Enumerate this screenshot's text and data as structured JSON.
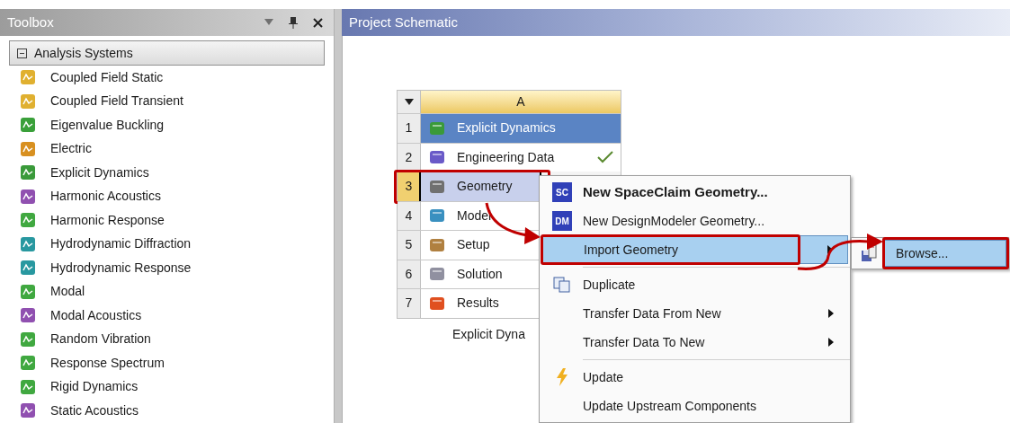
{
  "toolbox": {
    "title": "Toolbox",
    "section": {
      "label": "Analysis Systems",
      "expanded": true
    },
    "items": [
      {
        "label": "Coupled Field Static",
        "color": "#e0b030"
      },
      {
        "label": "Coupled Field Transient",
        "color": "#e0b030"
      },
      {
        "label": "Eigenvalue Buckling",
        "color": "#3aa03a"
      },
      {
        "label": "Electric",
        "color": "#d89020"
      },
      {
        "label": "Explicit Dynamics",
        "color": "#3a9a3a"
      },
      {
        "label": "Harmonic Acoustics",
        "color": "#9050b0"
      },
      {
        "label": "Harmonic Response",
        "color": "#40a840"
      },
      {
        "label": "Hydrodynamic Diffraction",
        "color": "#2898a0"
      },
      {
        "label": "Hydrodynamic Response",
        "color": "#2898a0"
      },
      {
        "label": "Modal",
        "color": "#40a840"
      },
      {
        "label": "Modal Acoustics",
        "color": "#9050b0"
      },
      {
        "label": "Random Vibration",
        "color": "#40a840"
      },
      {
        "label": "Response Spectrum",
        "color": "#40a840"
      },
      {
        "label": "Rigid Dynamics",
        "color": "#40a840"
      },
      {
        "label": "Static Acoustics",
        "color": "#9050b0"
      }
    ]
  },
  "schematic": {
    "title": "Project Schematic",
    "system": {
      "column": "A",
      "caption": "Explicit Dyna",
      "rows": [
        {
          "number": "1",
          "label": "Explicit Dynamics",
          "kind": "title",
          "selected": false,
          "checked": false,
          "annotated": false
        },
        {
          "number": "2",
          "label": "Engineering Data",
          "kind": "cell",
          "selected": false,
          "checked": true,
          "annotated": false
        },
        {
          "number": "3",
          "label": "Geometry",
          "kind": "cell",
          "selected": true,
          "checked": false,
          "annotated": true
        },
        {
          "number": "4",
          "label": "Model",
          "kind": "cell",
          "selected": false,
          "checked": false,
          "annotated": false
        },
        {
          "number": "5",
          "label": "Setup",
          "kind": "cell",
          "selected": false,
          "checked": false,
          "annotated": false
        },
        {
          "number": "6",
          "label": "Solution",
          "kind": "cell",
          "selected": false,
          "checked": false,
          "annotated": false
        },
        {
          "number": "7",
          "label": "Results",
          "kind": "cell",
          "selected": false,
          "checked": false,
          "annotated": false
        }
      ]
    }
  },
  "context_menu": {
    "items": [
      {
        "kind": "badge",
        "label": "New SpaceClaim Geometry...",
        "badge": "SC",
        "bold": true,
        "selected": false,
        "submenu": false,
        "annotated": false
      },
      {
        "kind": "badge",
        "label": "New DesignModeler Geometry...",
        "badge": "DM",
        "bold": false,
        "selected": false,
        "submenu": false,
        "annotated": false
      },
      {
        "kind": "item",
        "label": "Import Geometry",
        "bold": false,
        "selected": true,
        "submenu": true,
        "annotated": true
      },
      {
        "kind": "separator"
      },
      {
        "kind": "copy",
        "label": "Duplicate",
        "bold": false,
        "selected": false,
        "submenu": false,
        "annotated": false
      },
      {
        "kind": "item",
        "label": "Transfer Data From New",
        "bold": false,
        "selected": false,
        "submenu": true,
        "annotated": false
      },
      {
        "kind": "item",
        "label": "Transfer Data To New",
        "bold": false,
        "selected": false,
        "submenu": true,
        "annotated": false
      },
      {
        "kind": "separator"
      },
      {
        "kind": "lightning",
        "label": "Update",
        "bold": false,
        "selected": false,
        "submenu": false,
        "annotated": false
      },
      {
        "kind": "item",
        "label": "Update Upstream Components",
        "bold": false,
        "selected": false,
        "submenu": false,
        "annotated": false
      }
    ]
  },
  "submenu": {
    "items": [
      {
        "label": "Browse...",
        "selected": true,
        "annotated": true
      }
    ]
  }
}
